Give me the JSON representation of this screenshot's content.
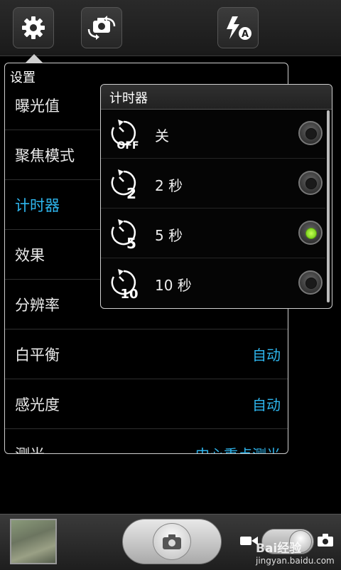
{
  "settings": {
    "title": "设置",
    "rows": [
      {
        "label": "曝光值",
        "value": ""
      },
      {
        "label": "聚焦模式",
        "value": ""
      },
      {
        "label": "计时器",
        "value": ""
      },
      {
        "label": "效果",
        "value": ""
      },
      {
        "label": "分辨率",
        "value": ""
      },
      {
        "label": "白平衡",
        "value": "自动"
      },
      {
        "label": "感光度",
        "value": "自动"
      },
      {
        "label": "测光",
        "value": "中心重点测光"
      }
    ]
  },
  "timer": {
    "title": "计时器",
    "options": [
      {
        "label": "关",
        "icon_text": "OFF",
        "selected": false
      },
      {
        "label": "2 秒",
        "icon_text": "2",
        "selected": false
      },
      {
        "label": "5 秒",
        "icon_text": "5",
        "selected": true
      },
      {
        "label": "10 秒",
        "icon_text": "10",
        "selected": false
      }
    ]
  },
  "toolbar": {
    "icons": [
      "gear-icon",
      "switch-camera-icon",
      "flash-auto-icon"
    ],
    "flash_badge": "A"
  },
  "watermark": {
    "brand": "Bai",
    "brand2": "经验",
    "url": "jingyan.baidu.com"
  },
  "colors": {
    "accent": "#2eb6ee",
    "selected_radio": "#7ed321"
  }
}
